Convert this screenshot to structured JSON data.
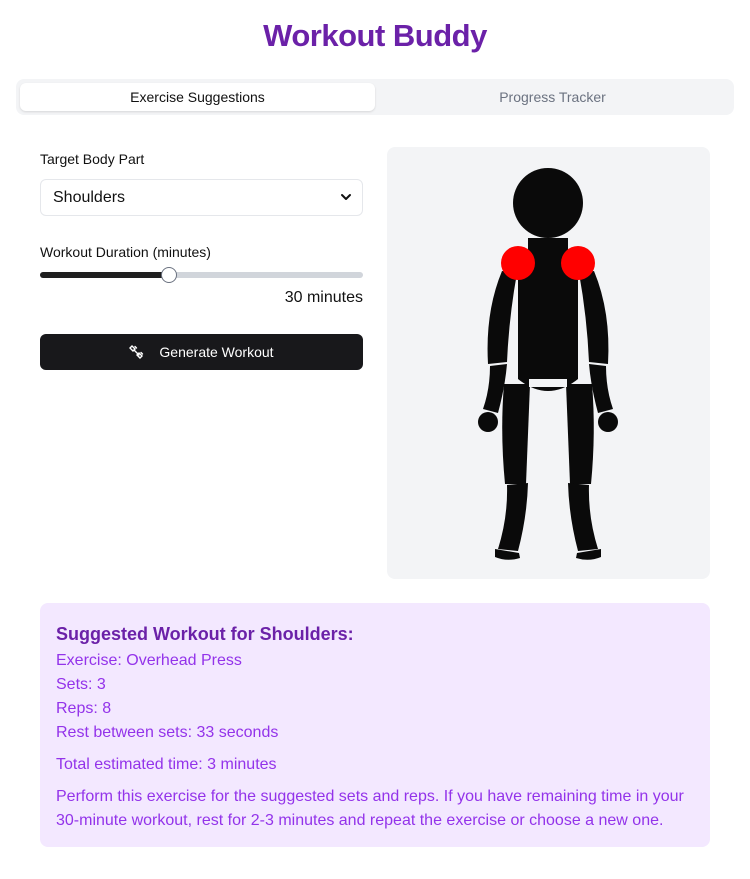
{
  "app": {
    "title": "Workout Buddy"
  },
  "tabs": [
    {
      "label": "Exercise Suggestions",
      "active": true
    },
    {
      "label": "Progress Tracker",
      "active": false
    }
  ],
  "form": {
    "body_part_label": "Target Body Part",
    "body_part_value": "Shoulders",
    "duration_label": "Workout Duration (minutes)",
    "duration_readout": "30 minutes",
    "duration_slider_fraction": 0.4,
    "generate_label": "Generate Workout",
    "generate_icon": "dumbbell-icon"
  },
  "figure": {
    "highlighted_part": "shoulders",
    "highlight_color": "#ff0000",
    "body_color": "#0a0a0a"
  },
  "result": {
    "title": "Suggested Workout for Shoulders:",
    "exercise": "Exercise: Overhead Press",
    "sets": "Sets: 3",
    "reps": "Reps: 8",
    "rest": "Rest between sets: 33 seconds",
    "total": "Total estimated time: 3 minutes",
    "note": "Perform this exercise for the suggested sets and reps. If you have remaining time in your 30-minute workout, rest for 2-3 minutes and repeat the exercise or choose a new one."
  },
  "colors": {
    "brand_purple": "#6b21a8",
    "result_bg": "#f3e8ff",
    "result_text": "#9333ea",
    "button_bg": "#18181b"
  }
}
